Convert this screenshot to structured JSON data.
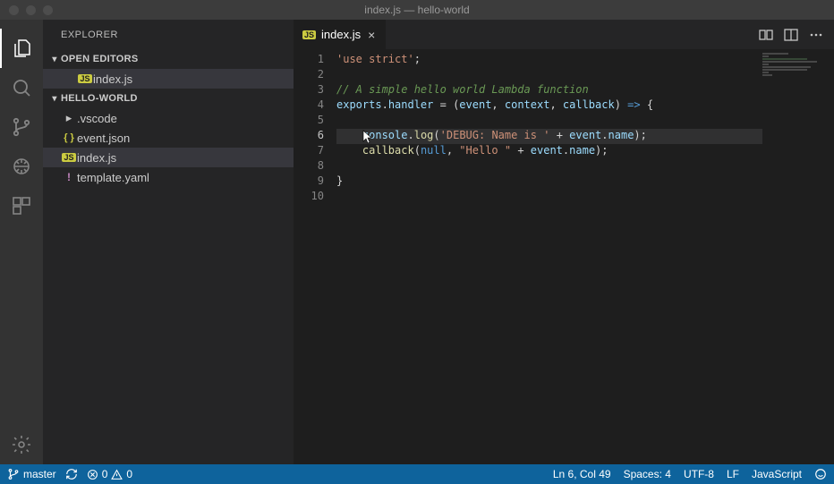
{
  "window": {
    "title": "index.js — hello-world"
  },
  "sidebar": {
    "title": "EXPLORER",
    "sections": {
      "openEditors": {
        "label": "OPEN EDITORS",
        "items": [
          {
            "icon": "JS",
            "name": "index.js"
          }
        ]
      },
      "folder": {
        "label": "HELLO-WORLD",
        "items": [
          {
            "type": "folder",
            "name": ".vscode"
          },
          {
            "type": "file",
            "icon": "json",
            "name": "event.json"
          },
          {
            "type": "file",
            "icon": "JS",
            "name": "index.js",
            "selected": true
          },
          {
            "type": "file",
            "icon": "yaml",
            "name": "template.yaml"
          }
        ]
      }
    }
  },
  "tabs": {
    "active": {
      "icon": "JS",
      "name": "index.js"
    }
  },
  "code": {
    "lines": [
      {
        "n": "1",
        "hl": false,
        "segs": [
          [
            "str",
            "'use strict'"
          ],
          [
            "pl",
            ";"
          ]
        ]
      },
      {
        "n": "2",
        "hl": false,
        "segs": []
      },
      {
        "n": "3",
        "hl": false,
        "segs": [
          [
            "com",
            "// A simple hello world Lambda function"
          ]
        ]
      },
      {
        "n": "4",
        "hl": false,
        "segs": [
          [
            "obj",
            "exports"
          ],
          [
            "pl",
            "."
          ],
          [
            "obj",
            "handler"
          ],
          [
            "pl",
            " = ("
          ],
          [
            "obj",
            "event"
          ],
          [
            "pl",
            ", "
          ],
          [
            "obj",
            "context"
          ],
          [
            "pl",
            ", "
          ],
          [
            "obj",
            "callback"
          ],
          [
            "pl",
            ") "
          ],
          [
            "kw",
            "=>"
          ],
          [
            "pl",
            " {"
          ]
        ]
      },
      {
        "n": "5",
        "hl": false,
        "segs": []
      },
      {
        "n": "6",
        "hl": true,
        "segs": [
          [
            "pl",
            "    "
          ],
          [
            "obj",
            "console"
          ],
          [
            "pl",
            "."
          ],
          [
            "fn",
            "log"
          ],
          [
            "pl",
            "("
          ],
          [
            "str",
            "'DEBUG: Name is '"
          ],
          [
            "pl",
            " + "
          ],
          [
            "obj",
            "event"
          ],
          [
            "pl",
            "."
          ],
          [
            "obj",
            "name"
          ],
          [
            "pl",
            ");"
          ]
        ]
      },
      {
        "n": "7",
        "hl": false,
        "segs": [
          [
            "pl",
            "    "
          ],
          [
            "fn",
            "callback"
          ],
          [
            "pl",
            "("
          ],
          [
            "kw",
            "null"
          ],
          [
            "pl",
            ", "
          ],
          [
            "str",
            "\"Hello \""
          ],
          [
            "pl",
            " + "
          ],
          [
            "obj",
            "event"
          ],
          [
            "pl",
            "."
          ],
          [
            "obj",
            "name"
          ],
          [
            "pl",
            ");"
          ]
        ]
      },
      {
        "n": "8",
        "hl": false,
        "segs": []
      },
      {
        "n": "9",
        "hl": false,
        "segs": [
          [
            "pl",
            "}"
          ]
        ]
      },
      {
        "n": "10",
        "hl": false,
        "segs": []
      }
    ],
    "currentLine": 6
  },
  "status": {
    "branch": "master",
    "errors": "0",
    "warnings": "0",
    "position": "Ln 6, Col 49",
    "spaces": "Spaces: 4",
    "encoding": "UTF-8",
    "eol": "LF",
    "language": "JavaScript"
  }
}
